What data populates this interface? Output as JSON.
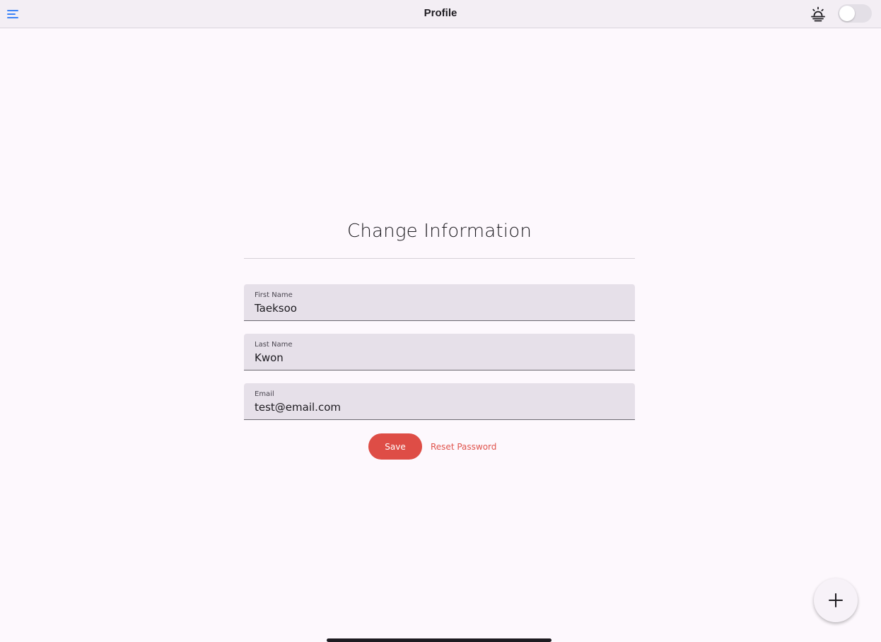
{
  "app_bar": {
    "title": "Profile",
    "menu_icon": "hamburger-menu-icon",
    "brightness_icon": "brightness-sunrise-icon",
    "theme_toggle": {
      "checked": false
    }
  },
  "form": {
    "title": "Change Information",
    "fields": [
      {
        "label": "First Name",
        "value": "Taeksoo"
      },
      {
        "label": "Last Name",
        "value": "Kwon"
      },
      {
        "label": "Email",
        "value": "test@email.com"
      }
    ],
    "save_label": "Save",
    "reset_label": "Reset Password"
  },
  "fab": {
    "icon": "plus-icon"
  },
  "colors": {
    "accent": "#de4d46",
    "menu_icon": "#3b82f6",
    "field_background": "#e6e0e9",
    "app_bar_background": "#f3eef4",
    "page_background": "#fdf8fd"
  }
}
